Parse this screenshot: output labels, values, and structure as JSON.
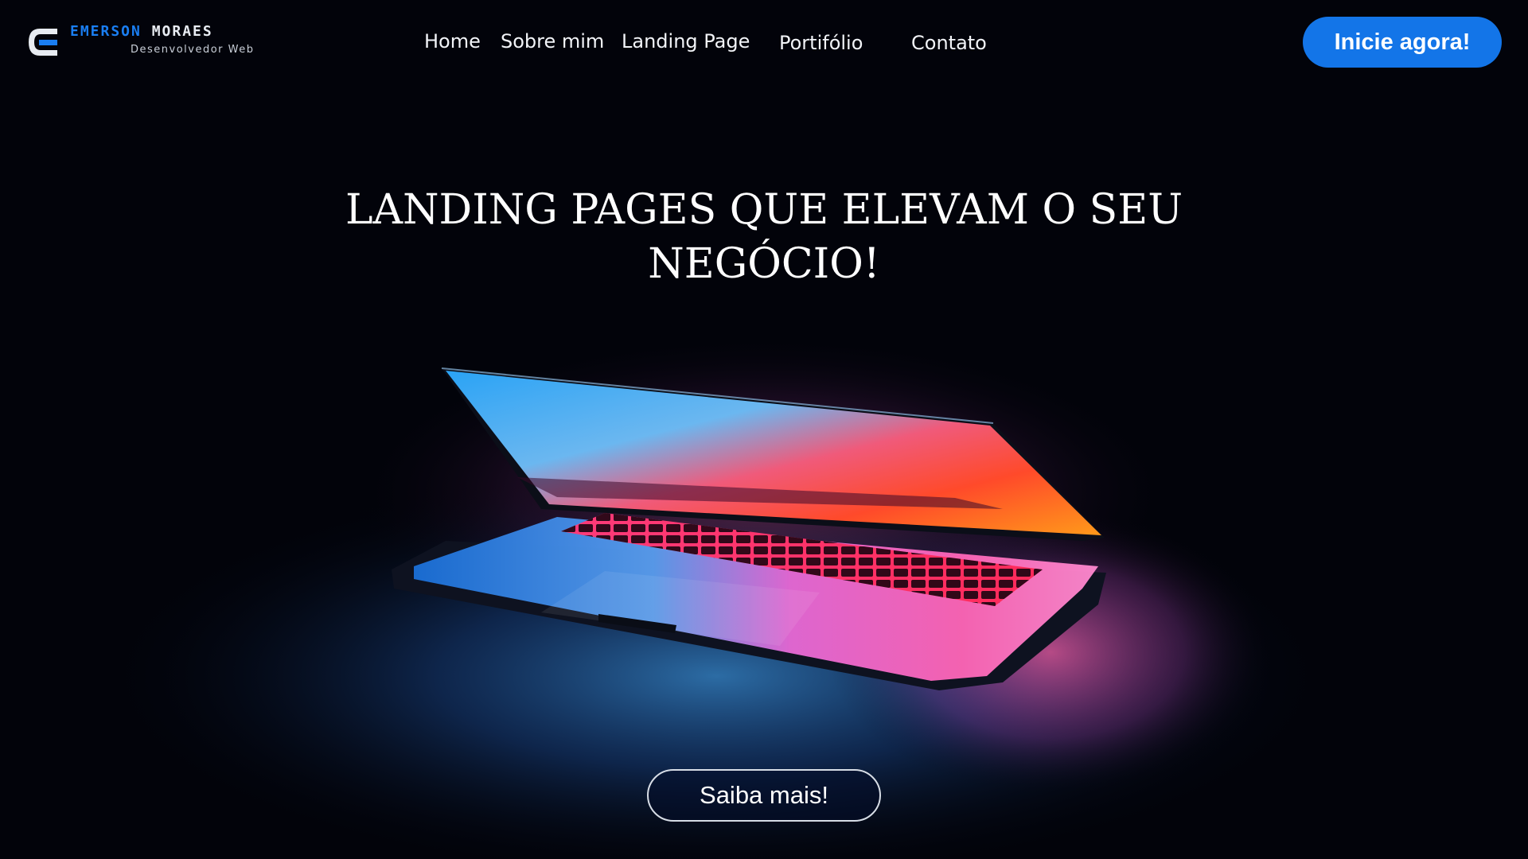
{
  "brand": {
    "first_name": "EMERSON",
    "last_name": "MORAES",
    "tagline": "Desenvolvedor Web"
  },
  "nav": {
    "items": [
      {
        "label": "Home"
      },
      {
        "label": "Sobre mim"
      },
      {
        "label": "Landing Page"
      },
      {
        "label": "Portifólio"
      },
      {
        "label": "Contato"
      }
    ]
  },
  "header": {
    "cta_label": "Inicie agora!"
  },
  "hero": {
    "title_line1": "LANDING PAGES QUE ELEVAM O SEU",
    "title_line2": "NEGÓCIO!",
    "button_label": "Saiba mais!"
  },
  "colors": {
    "background": "#02030a",
    "accent": "#1375e8",
    "brand_blue": "#1a7ef2",
    "text": "#ffffff"
  },
  "icons": {
    "logo": "letter-e-logo-icon",
    "hero_image": "laptop-photo"
  }
}
